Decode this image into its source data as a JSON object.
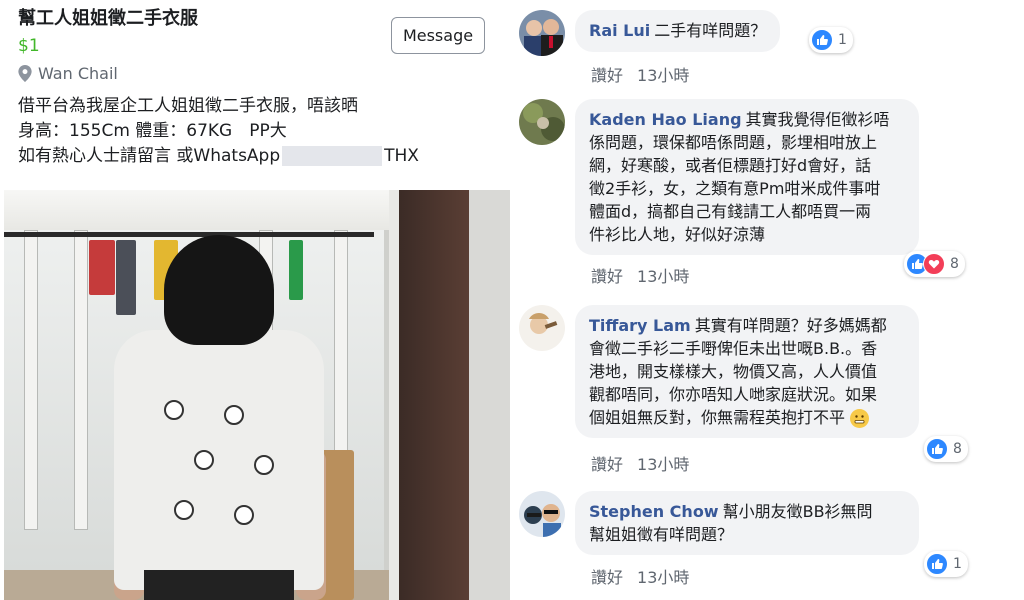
{
  "listing": {
    "title": "幫工人姐姐徵二手衣服",
    "price": "$1",
    "message_button": "Message",
    "location": "Wan Chail",
    "desc_line1": "借平台為我屋企工人姐姐徵二手衣服，唔該晒",
    "desc_line2": "身高：155Cm 體重：67KG　PP大",
    "desc_line3_a": "如有熱心人士請留言 或WhatsApp",
    "desc_line3_b": "THX",
    "icons": {
      "location": "map-pin-icon"
    }
  },
  "comments": [
    {
      "author": "Rai Lui",
      "text": "二手有咩問題？",
      "like_label": "讚好",
      "time": "13小時",
      "reaction_count": "1"
    },
    {
      "author": "Kaden Hao Liang",
      "lines": [
        "其實我覺得佢徵衫唔",
        "係問題，環保都唔係問題，影埋相咁放上",
        "網，好寒酸，或者佢標題打好d會好，話",
        "徵2手衫，女，之類有意Pm咁米成件事咁",
        "體面d，搞都自己有錢請工人都唔買一兩",
        "件衫比人地，好似好涼薄"
      ],
      "like_label": "讚好",
      "time": "13小時",
      "reaction_count": "8"
    },
    {
      "author": "Tiffary Lam",
      "lines": [
        "其實有咩問題？好多媽媽都",
        "會徵二手衫二手嘢俾佢未出世嘅B.B.。香",
        "港地，開支樣樣大，物價又高，人人價值",
        "觀都唔同，你亦唔知人哋家庭狀況。如果",
        "個姐姐無反對，你無需程英抱打不平"
      ],
      "like_label": "讚好",
      "time": "13小時",
      "reaction_count": "8"
    },
    {
      "author": "Stephen Chow",
      "lines": [
        "幫小朋友徵BB衫無問",
        "幫姐姐徵有咩問題？"
      ],
      "like_label": "讚好",
      "time": "13小時",
      "reaction_count": "1"
    }
  ],
  "colors": {
    "author_blue": "#385898",
    "price_green": "#42b72a",
    "like_blue": "#2d88ff",
    "love_red": "#f33e58",
    "bubble_bg": "#f2f3f5"
  }
}
